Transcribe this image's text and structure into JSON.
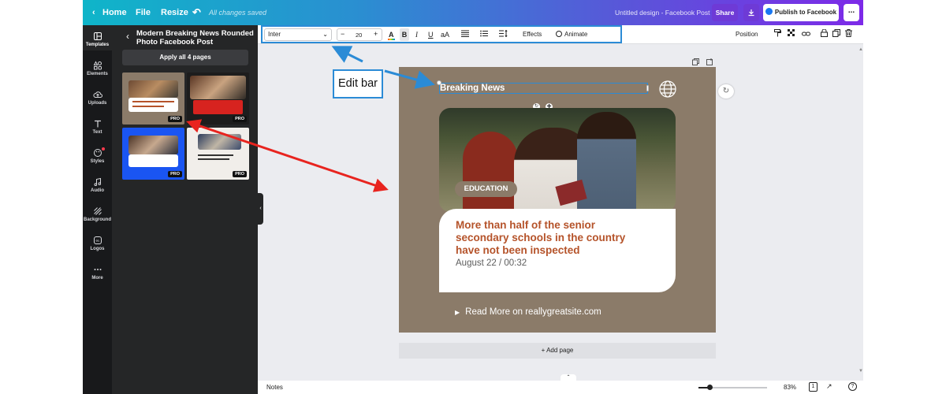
{
  "topbar": {
    "home": "Home",
    "file": "File",
    "resize": "Resize",
    "save_status": "All changes saved",
    "design_title": "Untitled design - Facebook Post",
    "share": "Share",
    "publish": "Publish to Facebook",
    "more": "..."
  },
  "rail": {
    "items": [
      {
        "label": "Templates",
        "icon": "templates-icon"
      },
      {
        "label": "Elements",
        "icon": "elements-icon"
      },
      {
        "label": "Uploads",
        "icon": "uploads-icon"
      },
      {
        "label": "Text",
        "icon": "text-icon"
      },
      {
        "label": "Styles",
        "icon": "styles-icon"
      },
      {
        "label": "Audio",
        "icon": "audio-icon"
      },
      {
        "label": "Background",
        "icon": "background-icon"
      },
      {
        "label": "Logos",
        "icon": "logos-icon"
      },
      {
        "label": "More",
        "icon": "more-icon"
      }
    ]
  },
  "panel": {
    "title": "Modern Breaking News Rounded Photo Facebook Post",
    "apply": "Apply all 4 pages",
    "pro_badge": "PRO"
  },
  "editbar": {
    "font": "Inter",
    "font_size": "20",
    "minus": "−",
    "plus": "+",
    "bold": "B",
    "italic": "I",
    "underline": "U",
    "case": "aA",
    "effects": "Effects",
    "animate": "Animate",
    "position": "Position"
  },
  "post": {
    "header": "Breaking News",
    "tag": "EDUCATION",
    "headline_line1": "More than half of the senior",
    "headline_line2": "secondary schools in the country",
    "headline_line3": "have not been inspected",
    "date": "August 22 / 00:32",
    "read_more": "Read More on reallygreatsite.com"
  },
  "add_page": "+ Add page",
  "bottombar": {
    "notes": "Notes",
    "zoom": "83%",
    "page_num": "1"
  },
  "annotation": {
    "label": "Edit bar"
  },
  "colors": {
    "canvas_bg": "#8b7b69",
    "headline": "#b5532a",
    "arrow_blue": "#2b8bd6",
    "arrow_red": "#e8241f"
  }
}
